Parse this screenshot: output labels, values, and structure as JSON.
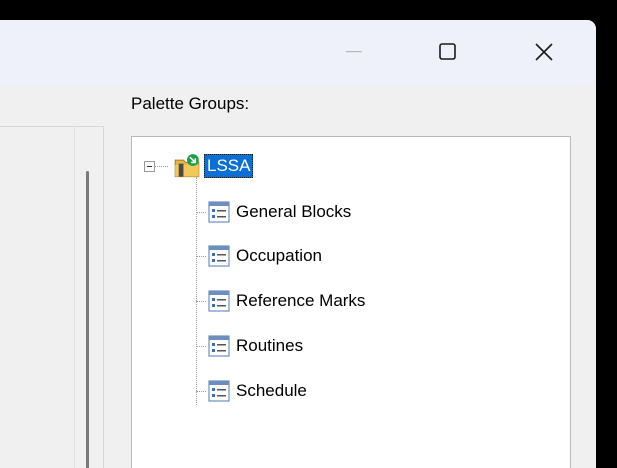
{
  "window": {
    "title_controls": {
      "minimize_icon": "minimize-icon",
      "maximize_icon": "maximize-icon",
      "close_icon": "close-icon"
    }
  },
  "palette": {
    "label": "Palette Groups:",
    "root": {
      "label": "LSSA",
      "icon": "folder-palette-icon",
      "expanded": true,
      "selected": true
    },
    "items": [
      {
        "label": "General Blocks",
        "icon": "palette-list-icon"
      },
      {
        "label": "Occupation",
        "icon": "palette-list-icon"
      },
      {
        "label": "Reference Marks",
        "icon": "palette-list-icon"
      },
      {
        "label": "Routines",
        "icon": "palette-list-icon"
      },
      {
        "label": "Schedule",
        "icon": "palette-list-icon"
      }
    ]
  },
  "colors": {
    "selection": "#0b6fd6",
    "titlebar": "#eef1f9",
    "background": "#000000"
  }
}
